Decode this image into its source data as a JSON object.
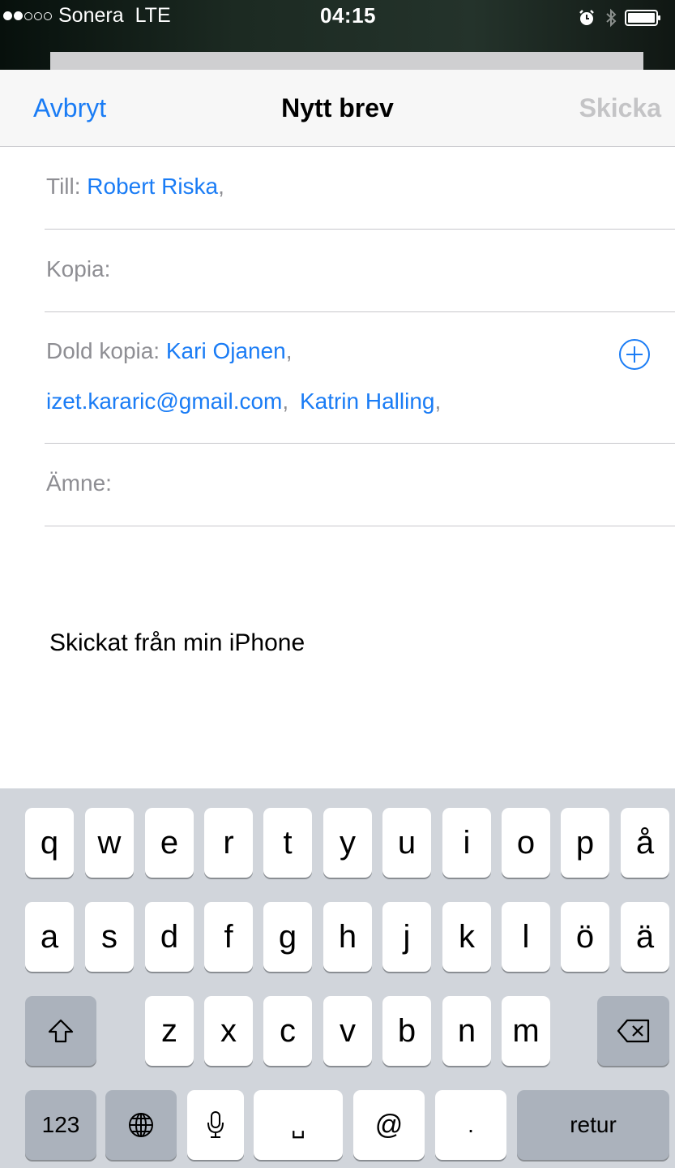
{
  "status_bar": {
    "carrier": "Sonera",
    "network": "LTE",
    "time": "04:15",
    "signal_bars_filled": 2,
    "signal_bars_total": 5,
    "icons": [
      "alarm-icon",
      "bluetooth-icon",
      "battery-icon"
    ]
  },
  "nav": {
    "cancel": "Avbryt",
    "title": "Nytt brev",
    "send": "Skicka"
  },
  "fields": {
    "to_label": "Till:",
    "to_recipients": [
      "Robert Riska"
    ],
    "cc_label": "Kopia:",
    "bcc_label": "Dold kopia:",
    "bcc_recipients": [
      "Kari Ojanen",
      "izet.kararic@gmail.com",
      "Katrin Halling"
    ],
    "subject_label": "Ämne:",
    "separator": ","
  },
  "body": {
    "signature": "Skickat från min iPhone"
  },
  "keyboard": {
    "row1": [
      "q",
      "w",
      "e",
      "r",
      "t",
      "y",
      "u",
      "i",
      "o",
      "p",
      "å"
    ],
    "row2": [
      "a",
      "s",
      "d",
      "f",
      "g",
      "h",
      "j",
      "k",
      "l",
      "ö",
      "ä"
    ],
    "row3": [
      "z",
      "x",
      "c",
      "v",
      "b",
      "n",
      "m"
    ],
    "numbers_key": "123",
    "at_key": "@",
    "period_key": ".",
    "space_key": "␣",
    "return_key": "retur"
  },
  "colors": {
    "accent": "#1a7cf5",
    "disabled": "#c4c4c6",
    "label_gray": "#8e8e93",
    "keyboard_bg": "#d1d5db",
    "dark_key": "#abb2bc"
  }
}
